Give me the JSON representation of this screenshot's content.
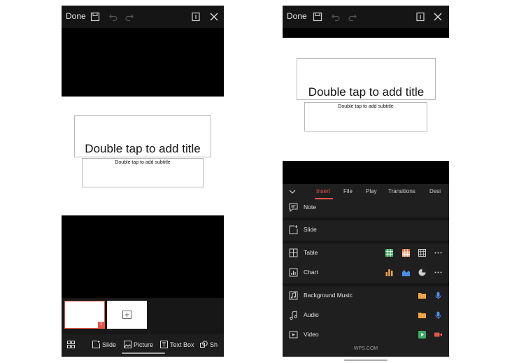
{
  "left_screen": {
    "topbar": {
      "done_label": "Done"
    },
    "slide": {
      "title_placeholder": "Double tap to add title",
      "subtitle_placeholder": "Double tap to add subtitle"
    },
    "thumbnail": {
      "number": "1"
    },
    "toolbar": [
      {
        "label": "",
        "icon": "grid-icon"
      },
      {
        "label": "Slide",
        "icon": "new-slide-icon"
      },
      {
        "label": "Picture",
        "icon": "picture-icon"
      },
      {
        "label": "Text Box",
        "icon": "text-box-icon"
      },
      {
        "label": "Sh",
        "icon": "shape-icon"
      }
    ]
  },
  "right_screen": {
    "topbar": {
      "done_label": "Done"
    },
    "slide": {
      "title_placeholder": "Double tap to add title",
      "subtitle_placeholder": "Double tap to add subtitle"
    },
    "tabs": [
      {
        "label": "Insert",
        "active": true
      },
      {
        "label": "File",
        "active": false
      },
      {
        "label": "Play",
        "active": false
      },
      {
        "label": "Transitions",
        "active": false
      },
      {
        "label": "Desi",
        "active": false
      }
    ],
    "insert_items": [
      {
        "label": "Note",
        "icon": "note-icon"
      },
      {
        "label": "Slide",
        "icon": "new-slide-icon"
      },
      {
        "label": "Table",
        "icon": "table-icon",
        "shortcuts": [
          "green-table-icon",
          "orange-table-icon",
          "grid-table-icon",
          "more-icon"
        ]
      },
      {
        "label": "Chart",
        "icon": "chart-icon",
        "shortcuts": [
          "bar-chart-icon",
          "area-chart-icon",
          "pie-chart-icon",
          "more-icon"
        ]
      },
      {
        "label": "Background Music",
        "icon": "background-music-icon",
        "shortcuts": [
          "folder-icon",
          "microphone-icon"
        ]
      },
      {
        "label": "Audio",
        "icon": "audio-icon",
        "shortcuts": [
          "folder-icon",
          "microphone-icon"
        ]
      },
      {
        "label": "Video",
        "icon": "video-icon",
        "shortcuts": [
          "play-icon",
          "camera-icon"
        ]
      }
    ],
    "footer": "WPS.COM"
  },
  "colors": {
    "accent": "#e4564a",
    "screen_background": "#000000",
    "panel_background": "#1f1f1f",
    "text_light": "#e4e4e4"
  }
}
